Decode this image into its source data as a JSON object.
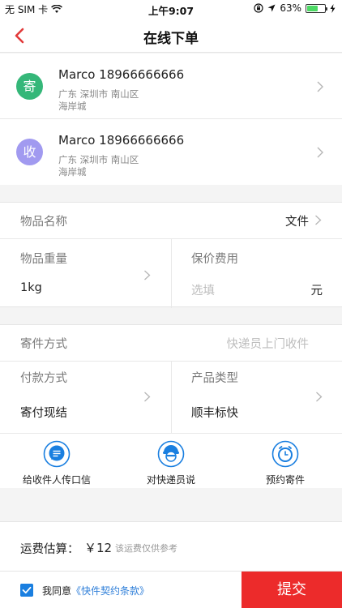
{
  "status_bar": {
    "carrier": "无 SIM 卡",
    "time": "上午9:07",
    "battery": "63%",
    "battery_level": 0.63
  },
  "nav": {
    "title": "在线下单"
  },
  "sender": {
    "badge": "寄",
    "badge_color": "#35b779",
    "name_phone": "Marco 18966666666",
    "region": "广东 深圳市 南山区",
    "detail": "海岸城"
  },
  "receiver": {
    "badge": "收",
    "badge_color": "#a19af0",
    "name_phone": "Marco 18966666666",
    "region": "广东 深圳市 南山区",
    "detail": "海岸城"
  },
  "cargo": {
    "item_name_label": "物品名称",
    "item_name_value": "文件",
    "weight_label": "物品重量",
    "weight_value": "1kg",
    "insurance_label": "保价费用",
    "insurance_placeholder": "选填",
    "insurance_unit": "元"
  },
  "method": {
    "send_label": "寄件方式",
    "send_value": "快递员上门收件",
    "payment_label": "付款方式",
    "payment_value": "寄付现结",
    "product_label": "产品类型",
    "product_value": "顺丰标快"
  },
  "actions": [
    {
      "label": "给收件人传口信",
      "icon": "message-icon"
    },
    {
      "label": "对快递员说",
      "icon": "courier-icon"
    },
    {
      "label": "预约寄件",
      "icon": "clock-icon"
    }
  ],
  "fee": {
    "label": "运费估算：",
    "amount": "￥12",
    "note": "该运费仅供参考"
  },
  "footer": {
    "agree_prefix": "我同意",
    "agree_link": "《快件契约条款》",
    "submit_label": "提交"
  },
  "colors": {
    "accent_red": "#ec2b2b",
    "icon_blue": "#1a7fe0"
  }
}
